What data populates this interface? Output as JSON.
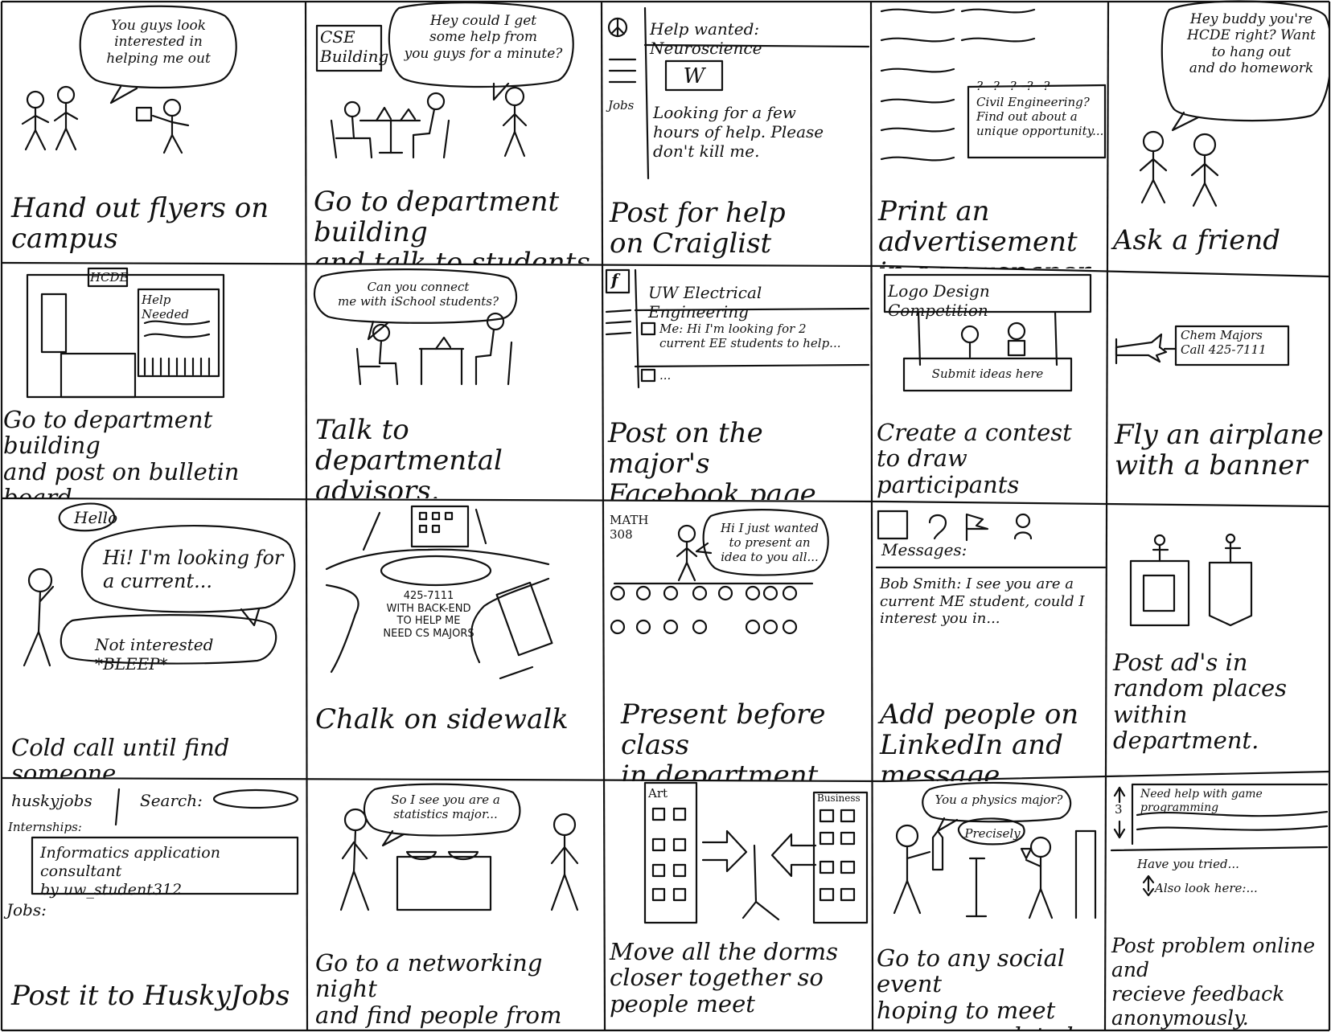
{
  "panels": [
    {
      "caption": "Hand out flyers on\ncampus",
      "bubble": "You guys look\ninterested in\nhelping me out"
    },
    {
      "caption": "Go to department building\nand talk to students there",
      "sign": "CSE\nBuilding",
      "bubble": "Hey could I get\nsome help from\nyou guys for a minute?"
    },
    {
      "caption": "Post for help\non Craiglist",
      "side": "Jobs",
      "header": "Help wanted: Neuroscience",
      "logo": "W",
      "body": "Looking for a few\nhours of help. Please\ndon't kill me."
    },
    {
      "caption": "Print an advertisement\nin a newspaper",
      "marks": "? ? ? ? ?",
      "ad": "Civil Engineering?\nFind out about a\nunique opportunity..."
    },
    {
      "caption": "Ask a friend",
      "bubble": "Hey buddy you're\nHCDE right? Want\nto hang out\nand do homework"
    },
    {
      "caption": "Go to department building\nand post on bulletin board",
      "sign": "HCDE",
      "board": "Help Needed"
    },
    {
      "caption": "Talk to departmental\nadvisors.",
      "bubble": "Can you connect\nme with iSchool students?"
    },
    {
      "caption": "Post on the major's\nFacebook page",
      "icon": "f",
      "group": "UW Electrical Engineering",
      "post": "Me: Hi I'm looking for 2\ncurrent EE students to help...",
      "more": "..."
    },
    {
      "caption": "Create a contest\nto draw participants",
      "banner": "Logo Design Competition",
      "booth": "Submit ideas here"
    },
    {
      "caption": "Fly an airplane\nwith a banner",
      "banner": "Chem Majors\nCall 425-7111"
    },
    {
      "caption": "Cold call until find someone",
      "hello": "Hello",
      "bubble": "Hi! I'm looking for\na current...",
      "reply": "Not interested *BLEEP*"
    },
    {
      "caption": "Chalk on sidewalk",
      "chalk": "425-7111\nWITH BACK-END\nTO HELP ME\nNEED CS MAJORS"
    },
    {
      "caption": "Present before class\nin department",
      "room": "MATH\n308",
      "bubble": "Hi I just wanted\nto present an\nidea to you all..."
    },
    {
      "caption": "Add people on\nLinkedIn and message",
      "label": "Messages:",
      "message": "Bob Smith: I see you are a\ncurrent ME student, could I\ninterest you in..."
    },
    {
      "caption": "Post ad's in\nrandom places within\ndepartment."
    },
    {
      "caption": "Post it to HuskyJobs",
      "brand": "huskyjobs",
      "search_label": "Search:",
      "internships_label": "Internships:",
      "listing": "Informatics application consultant\nby uw_student312",
      "jobs_label": "Jobs:"
    },
    {
      "caption": "Go to a networking night\nand find people from department",
      "bubble": "So I see you are a\nstatistics major..."
    },
    {
      "caption": "Move all the dorms\ncloser together so people meet",
      "left_building": "Art",
      "right_building": "Business"
    },
    {
      "caption": "Go to any social event\nhoping to meet someone related",
      "bubble": "You a physics major?",
      "reply": "Precisely"
    },
    {
      "caption": "Post problem online and\nrecieve feedback\nanonymously.",
      "question": "Need help with game programming",
      "votes": "3",
      "answer1": "Have you tried...",
      "answer2": "Also look here:..."
    }
  ]
}
